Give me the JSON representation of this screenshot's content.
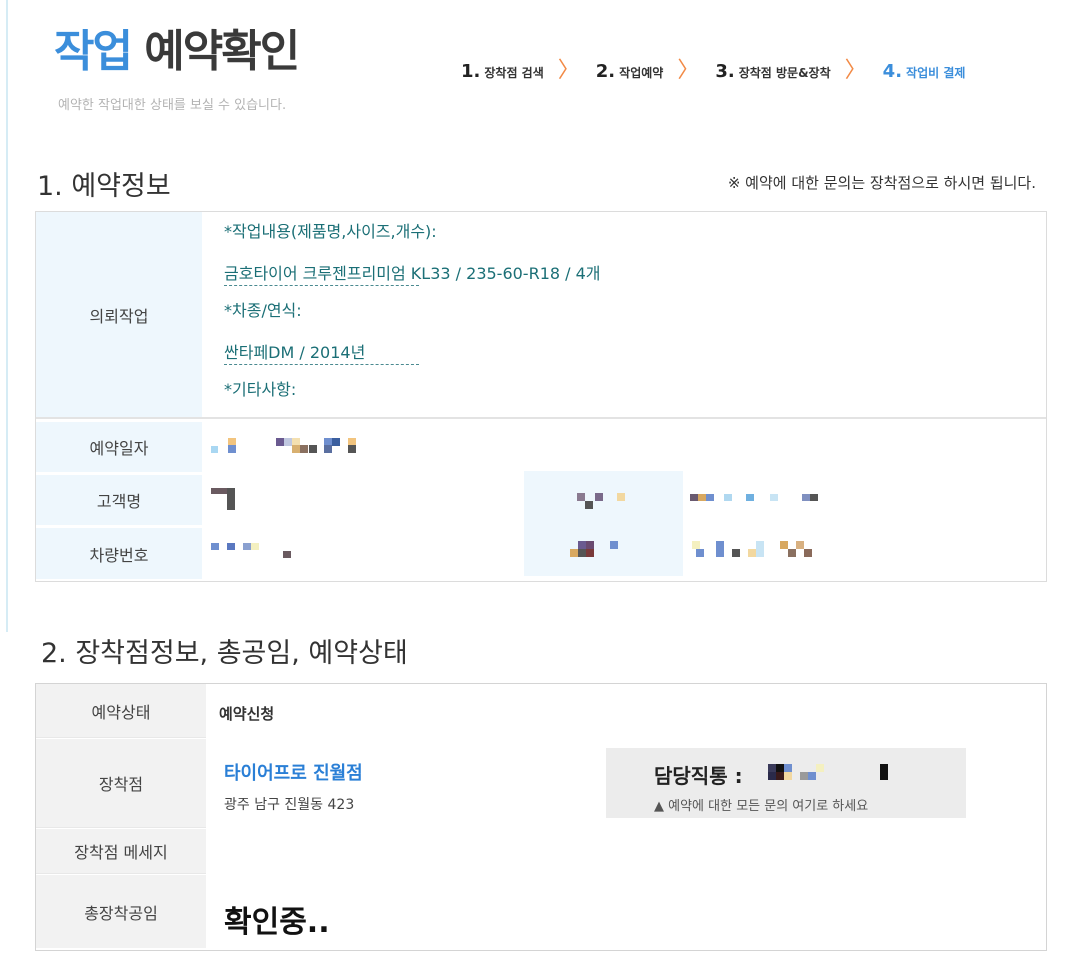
{
  "header": {
    "title_part1": "작업",
    "title_part2": "예약확인",
    "subtitle": "예약한 작업대한 상태를 보실 수 있습니다."
  },
  "steps": [
    {
      "num": "1.",
      "label": "장착점 검색",
      "active": false
    },
    {
      "num": "2.",
      "label": "작업예약",
      "active": false
    },
    {
      "num": "3.",
      "label": "장착점 방문&장착",
      "active": false
    },
    {
      "num": "4.",
      "label": "작업비 결제",
      "active": true
    }
  ],
  "section1": {
    "title": "1. 예약정보",
    "note": "※ 예약에 대한 문의는 장착점으로 하시면 됩니다.",
    "request_label": "의뢰작업",
    "request": {
      "work_label": "*작업내용(제품명,사이즈,개수):",
      "work_value": "금호타이어 크루젠프리미엄 KL33 / 235-60-R18 / 4개",
      "car_label": "*차종/연식:",
      "car_value": "싼타페DM / 2014년",
      "etc_label": "*기타사항:"
    },
    "rows": {
      "date_label": "예약일자",
      "customer_label": "고객명",
      "plate_label": "차량번호"
    }
  },
  "section2": {
    "title": "2. 장착점정보, 총공임, 예약상태",
    "status_label": "예약상태",
    "status_value": "예약신청",
    "shop_label": "장착점",
    "shop_name": "타이어프로 진월점",
    "shop_address": "광주 남구 진월동 423",
    "contact_label": "담당직통 :",
    "contact_note": "▲ 예약에 대한 모든 문의 여기로 하세요",
    "message_label": "장착점 메세지",
    "total_label": "총장착공임",
    "total_value": "확인중.."
  },
  "colors": {
    "accent_blue": "#3b8edb",
    "chevron_orange": "#f28a46",
    "request_text_teal": "#1b6f76",
    "label_bg_blue": "#eef7fd",
    "label_bg_gray": "#f2f2f2"
  },
  "icons": [
    "chevron-right-icon"
  ]
}
